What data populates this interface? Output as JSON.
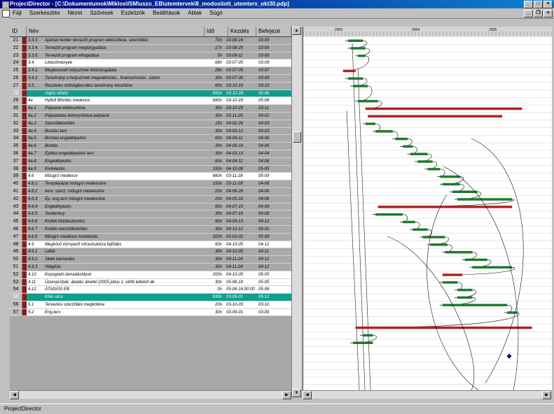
{
  "window": {
    "title": "ProjectDirector - [C:\\Dokumentumok\\Miklos\\ISM\\uszo_EB\\utemtervek\\8_modositott_utemterv_okt30.pdp]"
  },
  "menu": [
    "Fájl",
    "Szerkesztés",
    "Nézet",
    "Szűrések",
    "Eszközök",
    "Beállítások",
    "Ablak",
    "Súgó"
  ],
  "columns": {
    "id": "ID",
    "name": "Név",
    "duration": "Idő",
    "start": "Kezdés",
    "end": "Befejezé"
  },
  "rows": [
    {
      "n": "21",
      "code": "3.3.3.",
      "name": "Ajánlati tender tervezői program elkészítése, szerződés",
      "dur": "70n",
      "start": "03-08-16",
      "end": "03-09",
      "style": "g"
    },
    {
      "n": "22",
      "code": "3.3.4.",
      "name": "Tervezői program megtárgyalása",
      "dur": "17n",
      "start": "03-08-25",
      "end": "03-09",
      "style": "g"
    },
    {
      "n": "23",
      "code": "3.3.5.",
      "name": "Tervezői program elfogadása",
      "dur": "5n",
      "start": "03-09-11",
      "end": "03-09",
      "style": "g"
    },
    {
      "n": "24",
      "code": "3.4.",
      "name": "Létesítmények",
      "dur": "68n",
      "start": "03-07-05",
      "end": "03-09",
      "style": "w"
    },
    {
      "n": "25",
      "code": "3.4.1.",
      "name": "Megkeresett helyszínek felülvizsgálata",
      "dur": "28n",
      "start": "03-07-05",
      "end": "03-07",
      "style": "g"
    },
    {
      "n": "26",
      "code": "3.4.2.",
      "name": "Tanulmány a helyszínek megvalósítási , finanszírozási , üzem",
      "dur": "30n",
      "start": "03-07-30",
      "end": "03-09",
      "style": "g"
    },
    {
      "n": "27",
      "code": "3.5.",
      "name": "Részletes költségbecslési tanulmány készítése",
      "dur": "60n",
      "start": "03-10-16",
      "end": "03-10",
      "style": "g"
    },
    {
      "n": "28",
      "code": "",
      "name": "Hajós Alfréd",
      "dur": "690n",
      "start": "03-10-29",
      "end": "05-06",
      "style": "t"
    },
    {
      "n": "29",
      "code": "4a",
      "name": "Hyllofi Bővítés medence",
      "dur": "690n",
      "start": "03-10-29",
      "end": "05-06",
      "style": "w"
    },
    {
      "n": "30",
      "code": "4a.1",
      "name": "Pályázat előkészítése",
      "dur": "30n",
      "start": "03-10-29",
      "end": "03-11",
      "style": "g"
    },
    {
      "n": "31",
      "code": "4a.2",
      "name": "Pályáztatás lebonyolítása pályázat",
      "dur": "30n",
      "start": "03-11-26",
      "end": "04-01",
      "style": "g"
    },
    {
      "n": "32",
      "code": "4a.3",
      "name": "Szerződéskötés",
      "dur": "15n",
      "start": "04-02-26",
      "end": "04-03",
      "style": "g"
    },
    {
      "n": "33",
      "code": "4a.4",
      "name": "Bontási terv",
      "dur": "30n",
      "start": "04-03-12",
      "end": "04-03",
      "style": "g"
    },
    {
      "n": "34",
      "code": "4a.5",
      "name": "Bontási engedélyezés",
      "dur": "60n",
      "start": "04-04-11",
      "end": "04-06",
      "style": "g"
    },
    {
      "n": "35",
      "code": "4a.6",
      "name": "Bontás",
      "dur": "30n",
      "start": "04-06-16",
      "end": "04-06",
      "style": "g"
    },
    {
      "n": "36",
      "code": "4a.7",
      "name": "Építési engedélyezési terv",
      "dur": "30n",
      "start": "04-03-13",
      "end": "04-04",
      "style": "g"
    },
    {
      "n": "37",
      "code": "4a.8",
      "name": "Engedélyezés",
      "dur": "60n",
      "start": "04-04-11",
      "end": "04-06",
      "style": "g"
    },
    {
      "n": "38",
      "code": "4a.9",
      "name": "Kivitelezés",
      "dur": "150n",
      "start": "04-10-08",
      "end": "05-05",
      "style": "g"
    },
    {
      "n": "39",
      "code": "4.6",
      "name": "Műugró medence",
      "dur": "660n",
      "start": "03-11-28",
      "end": "05-09",
      "style": "w"
    },
    {
      "n": "40",
      "code": "4.6.1",
      "name": "Tervpályázat műugró medencére",
      "dur": "150n",
      "start": "03-11-28",
      "end": "04-06",
      "style": "g"
    },
    {
      "n": "41",
      "code": "4.6.2",
      "name": "tervr. szerz. műugró medencére",
      "dur": "20n",
      "start": "04-06-26",
      "end": "04-06",
      "style": "g"
    },
    {
      "n": "42",
      "code": "4.6.3",
      "name": "Ép. eng.terv műugró medencére",
      "dur": "20n",
      "start": "04-05-16",
      "end": "04-06",
      "style": "g"
    },
    {
      "n": "43",
      "code": "4.6.4",
      "name": "Engedélyezés",
      "dur": "60n",
      "start": "04-07-15",
      "end": "04-09",
      "style": "g"
    },
    {
      "n": "44",
      "code": "4.6.5",
      "name": "Tendertery",
      "dur": "30n",
      "start": "04-07-16",
      "end": "04-08",
      "style": "g"
    },
    {
      "n": "45",
      "code": "4.6.6",
      "name": "Kiviteli közbeszerzési",
      "dur": "90n",
      "start": "04-09-13",
      "end": "04-12",
      "style": "g"
    },
    {
      "n": "46",
      "code": "4.6.7",
      "name": "Kiviteli szerződéskötés",
      "dur": "30n",
      "start": "04-12-12",
      "end": "05-01",
      "style": "g"
    },
    {
      "n": "47",
      "code": "4.6.8",
      "name": "Műugró medence kivitelezés",
      "dur": "200n",
      "start": "05-03-02",
      "end": "05-09",
      "style": "g"
    },
    {
      "n": "48",
      "code": "4.9",
      "name": "Megkövö környező infrastruktúra fejlődés",
      "dur": "60n",
      "start": "04-10-05",
      "end": "04-12",
      "style": "w"
    },
    {
      "n": "49",
      "code": "4.9.1",
      "name": "Leltár",
      "dur": "30n",
      "start": "04-10-05",
      "end": "04-11",
      "style": "g"
    },
    {
      "n": "50",
      "code": "4.9.2",
      "name": "Játék kamarabu",
      "dur": "30n",
      "start": "04-11-24",
      "end": "04-12",
      "style": "g"
    },
    {
      "n": "51",
      "code": "4.9.3",
      "name": "Világítás",
      "dur": "30n",
      "start": "04-11-24",
      "end": "04-12",
      "style": "g"
    },
    {
      "n": "52",
      "code": "4.10",
      "name": "Kopogtató-támadásblyok",
      "dur": "200n",
      "start": "04-10-05",
      "end": "05-05",
      "style": "w"
    },
    {
      "n": "53",
      "code": "4.11",
      "name": "Üzempróbák, átadás átvétel (2005.július 1. előtti leltelvő de",
      "dur": "30n",
      "start": "05-06-19",
      "end": "05-05",
      "style": "w"
    },
    {
      "n": "54",
      "code": "4.12",
      "name": "ÁTADÁSI EB",
      "dur": "0n",
      "start": "05-06-16:00:00",
      "end": "05-06",
      "style": "w"
    },
    {
      "n": "55",
      "code": "",
      "name": "Köér utca",
      "dur": "830n",
      "start": "03-09-01",
      "end": "05-12",
      "style": "t"
    },
    {
      "n": "56",
      "code": "5.1",
      "name": "Tervezési szerződés megkötése",
      "dur": "20n",
      "start": "03-10-03",
      "end": "03-10",
      "style": "w"
    },
    {
      "n": "57",
      "code": "5.2",
      "name": "Eng.terv",
      "dur": "30n",
      "start": "03-09-01",
      "end": "03-09",
      "style": "w"
    }
  ],
  "timeline": {
    "years": [
      "2003",
      "2004",
      "2005"
    ]
  },
  "gantt_bars": [
    {
      "row": 0,
      "s": 0.18,
      "e": 0.24,
      "c": "green"
    },
    {
      "row": 1,
      "s": 0.19,
      "e": 0.25,
      "c": "green"
    },
    {
      "row": 2,
      "s": 0.22,
      "e": 0.25,
      "c": "green"
    },
    {
      "row": 4,
      "s": 0.16,
      "e": 0.21,
      "c": "red"
    },
    {
      "row": 5,
      "s": 0.18,
      "e": 0.24,
      "c": "green"
    },
    {
      "row": 6,
      "s": 0.2,
      "e": 0.26,
      "c": "green"
    },
    {
      "row": 8,
      "s": 0.22,
      "e": 0.3,
      "c": "green"
    },
    {
      "row": 9,
      "s": 0.25,
      "e": 0.88,
      "c": "red"
    },
    {
      "row": 10,
      "s": 0.26,
      "e": 0.8,
      "c": "red"
    },
    {
      "row": 11,
      "s": 0.25,
      "e": 0.29,
      "c": "green"
    },
    {
      "row": 12,
      "s": 0.29,
      "e": 0.36,
      "c": "green"
    },
    {
      "row": 13,
      "s": 0.37,
      "e": 0.42,
      "c": "green"
    },
    {
      "row": 14,
      "s": 0.4,
      "e": 0.44,
      "c": "green"
    },
    {
      "row": 15,
      "s": 0.43,
      "e": 0.5,
      "c": "green"
    },
    {
      "row": 16,
      "s": 0.46,
      "e": 0.52,
      "c": "green"
    },
    {
      "row": 17,
      "s": 0.5,
      "e": 0.55,
      "c": "green"
    },
    {
      "row": 18,
      "s": 0.55,
      "e": 0.63,
      "c": "green"
    },
    {
      "row": 19,
      "s": 0.56,
      "e": 0.63,
      "c": "green"
    },
    {
      "row": 20,
      "s": 0.6,
      "e": 0.7,
      "c": "green"
    },
    {
      "row": 21,
      "s": 0.62,
      "e": 0.84,
      "c": "green"
    },
    {
      "row": 22,
      "s": 0.3,
      "e": 0.84,
      "c": "red"
    },
    {
      "row": 23,
      "s": 0.29,
      "e": 0.4,
      "c": "green"
    },
    {
      "row": 24,
      "s": 0.4,
      "e": 0.45,
      "c": "green"
    },
    {
      "row": 25,
      "s": 0.44,
      "e": 0.5,
      "c": "green"
    },
    {
      "row": 26,
      "s": 0.48,
      "e": 0.57,
      "c": "green"
    },
    {
      "row": 27,
      "s": 0.51,
      "e": 0.58,
      "c": "green"
    },
    {
      "row": 28,
      "s": 0.57,
      "e": 0.68,
      "c": "green"
    },
    {
      "row": 29,
      "s": 0.65,
      "e": 0.74,
      "c": "green"
    },
    {
      "row": 30,
      "s": 0.68,
      "e": 0.84,
      "c": "green"
    },
    {
      "row": 31,
      "s": 0.56,
      "e": 0.64,
      "c": "red"
    },
    {
      "row": 32,
      "s": 0.56,
      "e": 0.62,
      "c": "green"
    },
    {
      "row": 33,
      "s": 0.62,
      "e": 0.68,
      "c": "green"
    },
    {
      "row": 34,
      "s": 0.62,
      "e": 0.68,
      "c": "green"
    },
    {
      "row": 35,
      "s": 0.56,
      "e": 0.82,
      "c": "green"
    },
    {
      "row": 36,
      "s": 0.82,
      "e": 0.86,
      "c": "green"
    },
    {
      "row": 38,
      "s": 0.21,
      "e": 0.92,
      "c": "red"
    },
    {
      "row": 39,
      "s": 0.24,
      "e": 0.28,
      "c": "green"
    },
    {
      "row": 40,
      "s": 0.2,
      "e": 0.28,
      "c": "green"
    }
  ],
  "status": {
    "text": "ProjectDirector"
  },
  "colors": {
    "titlebar": "#000080",
    "teal": "#0f9d8e",
    "bar_red": "#b22222",
    "bar_green": "#1e7b2e"
  }
}
